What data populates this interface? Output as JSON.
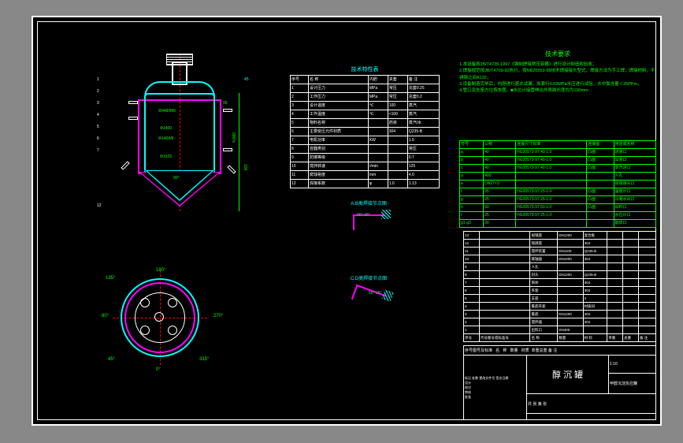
{
  "title_block": {
    "main_title": "醇 沉 罐",
    "subtitle": "甲醇沉淀反应罐",
    "scale": "1:10",
    "sheet": "共 张 第 张"
  },
  "tech_notes": {
    "title": "技术要求",
    "lines": [
      "1.本设备按JB/T4735-1997《钢制焊接常压容器》进行设计制造和验收；",
      "2.焊接规范按JB/T4709-92执行，按NB20553-98技术焊接接头型式，焊接方法为手工焊；焊接材料，不锈钢之间A132，",
      "3.设备制造完毕后，内胆进行盛水试漏，夹套行0.53MPa水压进行试验，水中氯含量＜25PPm，",
      "4.管口及支座方位按本图，■水位计接管伸出外表面长度均为100mm"
    ]
  },
  "tech_table": {
    "title": "技术特性表",
    "header": [
      "序号",
      "名 称",
      "内胆",
      "夹套",
      "备 注"
    ],
    "rows": [
      [
        "1",
        "设计压力",
        "MPa",
        "常压",
        "充套0.25"
      ],
      [
        "2",
        "工作压力",
        "MPa",
        "常压",
        "充套0.2"
      ],
      [
        "3",
        "设计温度",
        "℃",
        "100",
        "蒸汽"
      ],
      [
        "4",
        "工作温度",
        "℃",
        "<100",
        "蒸汽"
      ],
      [
        "5",
        "物料名称",
        "",
        "药液",
        "蒸汽/水"
      ],
      [
        "6",
        "主要受压元件材质",
        "",
        "304",
        "Q235-B"
      ],
      [
        "7",
        "电机功率",
        "KW",
        "",
        "1.5"
      ],
      [
        "8",
        "容器类别",
        "",
        "",
        "常压"
      ],
      [
        "9",
        "防爆等级",
        "",
        "",
        "0.7"
      ],
      [
        "10",
        "搅拌转速",
        "r/min",
        "",
        "125"
      ],
      [
        "11",
        "腐蚀裕度",
        "mm",
        "",
        "4.0"
      ],
      [
        "12",
        "焊接系数",
        "φ",
        "1.0",
        "1.13"
      ]
    ]
  },
  "nozzle_table": {
    "header": [
      "符号",
      "公称",
      "连接尺寸标准",
      "连接面",
      "用途或名称"
    ],
    "rows": [
      [
        "a",
        "40",
        "HG20573-97 40-1.0",
        "凸面",
        "进液口"
      ],
      [
        "b",
        "40",
        "HG20573-97 40-1.0",
        "凸面",
        "出液口"
      ],
      [
        "c",
        "40",
        "HG20573-97 40-1.0",
        "凸面",
        "蒸汽进口"
      ],
      [
        "d",
        "400",
        "",
        "",
        "人孔"
      ],
      [
        "e",
        "DN27×3",
        "",
        "",
        "视镜接头口"
      ],
      [
        "f",
        "25",
        "HG20573-97 25-1.0",
        "凸面",
        "温度计口"
      ],
      [
        "g",
        "25",
        "HG20573-97 25-1.0",
        "凸面",
        "冷凝水出口"
      ],
      [
        "h",
        "50",
        "HG20573-97 50-1.0",
        "凸面",
        "出料口"
      ],
      [
        "i",
        "25",
        "HG20573-97 25-1.0",
        "",
        "水位计口"
      ],
      [
        "g1-g3",
        "20",
        "",
        "",
        "取样口"
      ]
    ]
  },
  "bom": {
    "header": [
      "序号",
      "代号图号或标准号",
      "名 称",
      "数量",
      "材 料",
      "单重",
      "总重",
      "备 注"
    ],
    "rows": [
      [
        "13",
        "",
        "视镜座",
        "DN1200",
        "复合板",
        "",
        "",
        ""
      ],
      [
        "12",
        "",
        "铭牌座",
        "",
        "304",
        "",
        "",
        ""
      ],
      [
        "11",
        "",
        "搅拌装置",
        "DN1100",
        "Q235-B",
        "",
        "",
        ""
      ],
      [
        "10",
        "",
        "联轴器",
        "DN1000",
        "304",
        "",
        "",
        ""
      ],
      [
        "9",
        "",
        "人孔",
        "",
        "",
        "",
        "",
        ""
      ],
      [
        "8",
        "",
        "封头",
        "DN1200",
        "Q235-B",
        "",
        "",
        ""
      ],
      [
        "7",
        "",
        "筒体",
        "",
        "304",
        "",
        "",
        ""
      ],
      [
        "6",
        "",
        "夹套",
        "",
        "304",
        "",
        "",
        ""
      ],
      [
        "5",
        "",
        "支座",
        "",
        "4",
        "",
        "",
        ""
      ],
      [
        "4",
        "",
        "锥底夹套",
        "",
        "材质同",
        "",
        "",
        ""
      ],
      [
        "3",
        "",
        "锥底",
        "DN1200",
        "304",
        "",
        "",
        ""
      ],
      [
        "2",
        "",
        "搅拌器",
        "",
        "304",
        "",
        "",
        ""
      ],
      [
        "1",
        "",
        "出料口",
        "DN400",
        "",
        "",
        "",
        ""
      ]
    ]
  },
  "dimensions": {
    "d1": "Φ948/956",
    "d2": "Φ1400",
    "d3": "Φ1404/8",
    "d4": "Φ1525",
    "h1": "995%",
    "h2": "100",
    "h3": "95",
    "a1": "90°"
  },
  "detail_a": {
    "title": "A.B类焊接节点图",
    "angle": "90° ±5°"
  },
  "detail_b": {
    "title": "C.D类焊接节点图",
    "angle": "55° ±5°"
  },
  "top_angles": {
    "a0": "0°",
    "a45": "45°",
    "a80": "80°",
    "a135": "135°",
    "a180": "180°",
    "a270": "270°",
    "a315": "315°"
  }
}
